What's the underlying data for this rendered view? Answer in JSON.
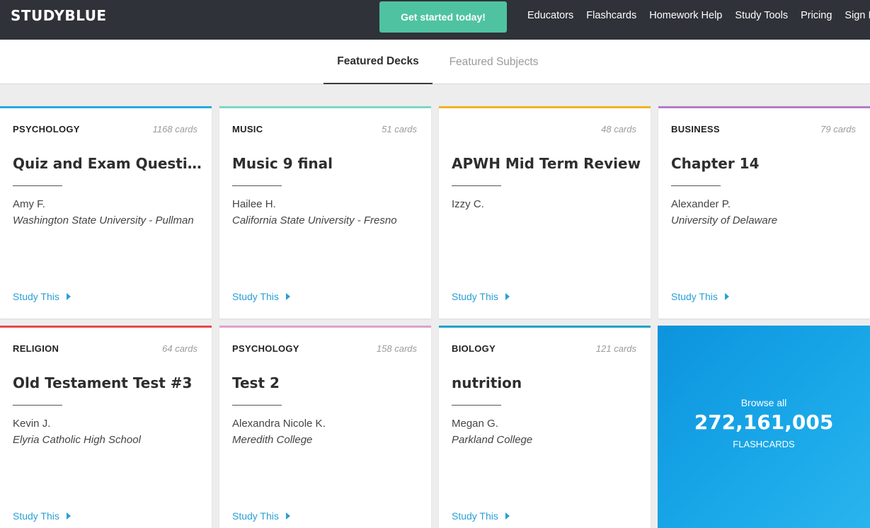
{
  "header": {
    "logo": "STUDYBLUE",
    "cta": "Get started today!",
    "nav": [
      "Educators",
      "Flashcards",
      "Homework Help",
      "Study Tools",
      "Pricing",
      "Sign In"
    ]
  },
  "tabs": {
    "active": "Featured Decks",
    "inactive": "Featured Subjects"
  },
  "study_label": "Study This",
  "decks": [
    {
      "subject": "PSYCHOLOGY",
      "count": "1168 cards",
      "title": "Quiz and Exam Questions",
      "author": "Amy F.",
      "school": "Washington State University - Pullman",
      "color": "#29a9e0"
    },
    {
      "subject": "MUSIC",
      "count": "51 cards",
      "title": "Music 9 final",
      "author": "Hailee H.",
      "school": "California State University - Fresno",
      "color": "#7dd8c5"
    },
    {
      "subject": "",
      "count": "48 cards",
      "title": "APWH Mid Term Review",
      "author": "Izzy C.",
      "school": "",
      "color": "#f0b323"
    },
    {
      "subject": "BUSINESS",
      "count": "79 cards",
      "title": "Chapter 14",
      "author": "Alexander P.",
      "school": "University of Delaware",
      "color": "#b27ec9"
    },
    {
      "subject": "RELIGION",
      "count": "64 cards",
      "title": "Old Testament Test #3",
      "author": "Kevin J.",
      "school": "Elyria Catholic High School",
      "color": "#e8474c"
    },
    {
      "subject": "PSYCHOLOGY",
      "count": "158 cards",
      "title": "Test 2",
      "author": "Alexandra Nicole K.",
      "school": "Meredith College",
      "color": "#dba3c8"
    },
    {
      "subject": "BIOLOGY",
      "count": "121 cards",
      "title": "nutrition",
      "author": "Megan G.",
      "school": "Parkland College",
      "color": "#1ba3c6"
    }
  ],
  "browse": {
    "line1": "Browse all",
    "number": "272,161,005",
    "line3": "FLASHCARDS"
  }
}
